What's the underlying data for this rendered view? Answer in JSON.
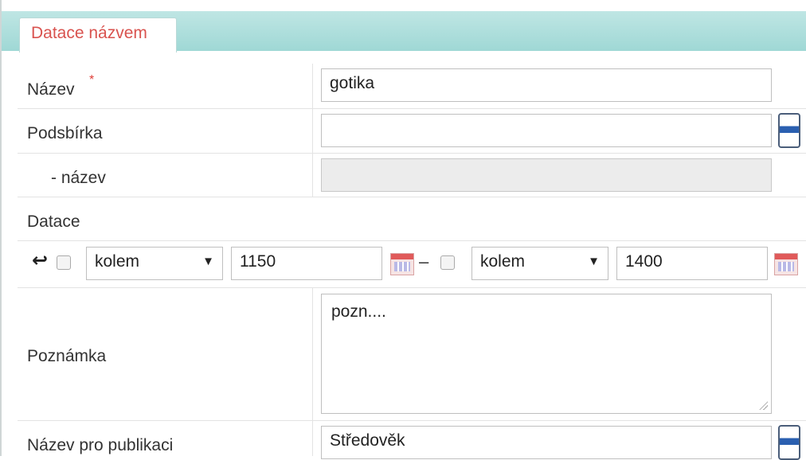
{
  "tab": {
    "title": "Datace názvem"
  },
  "fields": {
    "nazev": {
      "label": "Název",
      "required_mark": "*",
      "value": "gotika"
    },
    "podsbirka": {
      "label": "Podsbírka",
      "value": ""
    },
    "podsbirka_nazev": {
      "label": "- název",
      "value": ""
    },
    "datace": {
      "label": "Datace",
      "from": {
        "qualifier": "kolem",
        "year": "1150"
      },
      "separator": "–",
      "to": {
        "qualifier": "kolem",
        "year": "1400"
      }
    },
    "poznamka": {
      "label": "Poznámka",
      "value": "pozn...."
    },
    "nazev_publikace": {
      "label": "Název pro publikaci",
      "value": "Středověk"
    }
  },
  "icons": {
    "undo": "↩",
    "dropdown_arrow": "▼"
  },
  "colors": {
    "accent": "#d9534f",
    "header": "#a8dbd8"
  }
}
